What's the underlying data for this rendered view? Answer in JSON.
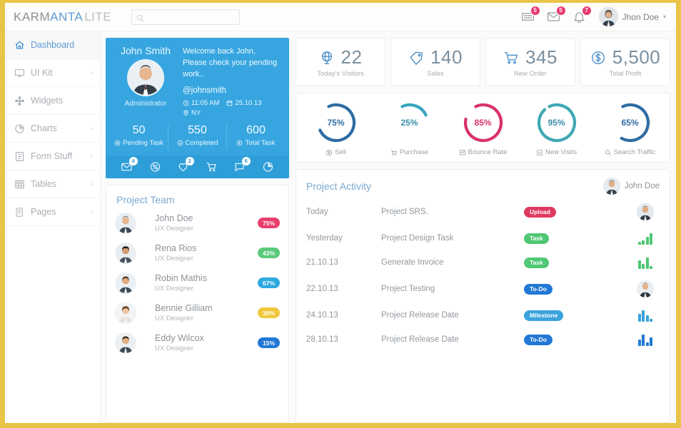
{
  "header": {
    "logo_primary": "KARM",
    "logo_accent": "ANTA",
    "logo_suffix": "LITE",
    "search_placeholder": "",
    "search_value": "",
    "search_icon": "search-icon",
    "icons": [
      {
        "name": "list-icon",
        "badge": "5"
      },
      {
        "name": "envelope-icon",
        "badge": "5"
      },
      {
        "name": "bell-icon",
        "badge": "7"
      }
    ],
    "user": {
      "name": "Jhon Doe",
      "caret": "▾"
    }
  },
  "sidebar": {
    "items": [
      {
        "label": "Dashboard",
        "icon": "home-icon",
        "active": true,
        "chevron": ""
      },
      {
        "label": "UI Kit",
        "icon": "monitor-icon",
        "active": false,
        "chevron": "›"
      },
      {
        "label": "Widgets",
        "icon": "widgets-icon",
        "active": false,
        "chevron": ""
      },
      {
        "label": "Charts",
        "icon": "pie-chart-icon",
        "active": false,
        "chevron": "›"
      },
      {
        "label": "Form Stuff",
        "icon": "form-icon",
        "active": false,
        "chevron": "›"
      },
      {
        "label": "Tables",
        "icon": "table-icon",
        "active": false,
        "chevron": "›"
      },
      {
        "label": "Pages",
        "icon": "pages-icon",
        "active": false,
        "chevron": "›"
      }
    ]
  },
  "profile": {
    "name": "John Smith",
    "role": "Administrator",
    "welcome": "Welcome back John, Please check your pending work..",
    "handle": "@johnsmith",
    "time": "11:05 AM",
    "date": "25.10.13",
    "location": "NY",
    "stats": [
      {
        "value": "50",
        "label": "Pending Task",
        "icon": "close-circle-icon"
      },
      {
        "value": "550",
        "label": "Completed",
        "icon": "check-circle-icon"
      },
      {
        "value": "600",
        "label": "Total Task",
        "icon": "plus-circle-icon"
      }
    ],
    "icon_bar": [
      {
        "name": "envelope-icon",
        "badge": "4"
      },
      {
        "name": "percent-icon",
        "badge": ""
      },
      {
        "name": "heart-icon",
        "badge": "2"
      },
      {
        "name": "cart-icon",
        "badge": ""
      },
      {
        "name": "chat-icon",
        "badge": "6"
      },
      {
        "name": "pie-chart-icon",
        "badge": ""
      }
    ],
    "bg_color": "#37a6e0"
  },
  "project_team": {
    "title": "Project Team",
    "members": [
      {
        "name": "John Doe",
        "role": "UX Designer",
        "pct": "75%",
        "color": "#ea3e6e"
      },
      {
        "name": "Rena Rios",
        "role": "UX Designer",
        "pct": "43%",
        "color": "#5bc97a"
      },
      {
        "name": "Robin Mathis",
        "role": "UX Designer",
        "pct": "67%",
        "color": "#2fa8e0"
      },
      {
        "name": "Bennie Gilliam",
        "role": "UX Designer",
        "pct": "30%",
        "color": "#f0c83c"
      },
      {
        "name": "Eddy Wilcox",
        "role": "UX Designer",
        "pct": "15%",
        "color": "#2278d4"
      }
    ]
  },
  "kpis": [
    {
      "value": "22",
      "label": "Today's Visitors",
      "icon": "globe-icon"
    },
    {
      "value": "140",
      "label": "Sales",
      "icon": "tag-icon"
    },
    {
      "value": "345",
      "label": "New Order",
      "icon": "cart-icon"
    },
    {
      "value": "5,500",
      "label": "Total Profit",
      "icon": "dollar-icon"
    }
  ],
  "chart_data": {
    "type": "pie",
    "title": "Performance donuts",
    "series": [
      {
        "name": "Sell",
        "value": 75,
        "label": "75%",
        "color": "#2e6ca4",
        "icon": "dollar-circle-icon"
      },
      {
        "name": "Purchase",
        "value": 25,
        "label": "25%",
        "color": "#36a6bd",
        "icon": "cart-icon"
      },
      {
        "name": "Bounce Rate",
        "value": 85,
        "label": "85%",
        "color": "#d8326a",
        "icon": "bounce-icon"
      },
      {
        "name": "New Visits",
        "value": 95,
        "label": "95%",
        "color": "#3fa8b4",
        "icon": "chart-icon"
      },
      {
        "name": "Search Traffic",
        "value": 65,
        "label": "65%",
        "color": "#2e6ca4",
        "icon": "search-icon"
      }
    ],
    "ylim": [
      0,
      100
    ],
    "legend": "below-each"
  },
  "project_activity": {
    "title": "Project Activity",
    "owner": "John Doe",
    "rows": [
      {
        "date": "Today",
        "task": "Project SRS.",
        "badge": "Upload",
        "badge_color": "#e03a63",
        "end": "avatar",
        "bars": []
      },
      {
        "date": "Yesterday",
        "task": "Project Design Task",
        "badge": "Task",
        "badge_color": "#4fc775",
        "end": "spark",
        "bars": [
          4,
          6,
          11,
          16
        ],
        "bar_color": "#4fc775"
      },
      {
        "date": "21.10.13",
        "task": "Generate Invoice",
        "badge": "Task",
        "badge_color": "#4fc775",
        "end": "spark",
        "bars": [
          12,
          7,
          16,
          4
        ],
        "bar_color": "#4fc775"
      },
      {
        "date": "22.10.13",
        "task": "Project Testing",
        "badge": "To-Do",
        "badge_color": "#2278d4",
        "end": "avatar",
        "bars": []
      },
      {
        "date": "24.10.13",
        "task": "Project Release Date",
        "badge": "Milestone",
        "badge_color": "#3aa3dd",
        "end": "spark",
        "bars": [
          11,
          16,
          9,
          4
        ],
        "bar_color": "#3aa3dd"
      },
      {
        "date": "28.10.13",
        "task": "Project Release Date",
        "badge": "To-Do",
        "badge_color": "#2278d4",
        "end": "spark",
        "bars": [
          9,
          16,
          5,
          12
        ],
        "bar_color": "#2278d4"
      }
    ]
  },
  "footer_note": ""
}
